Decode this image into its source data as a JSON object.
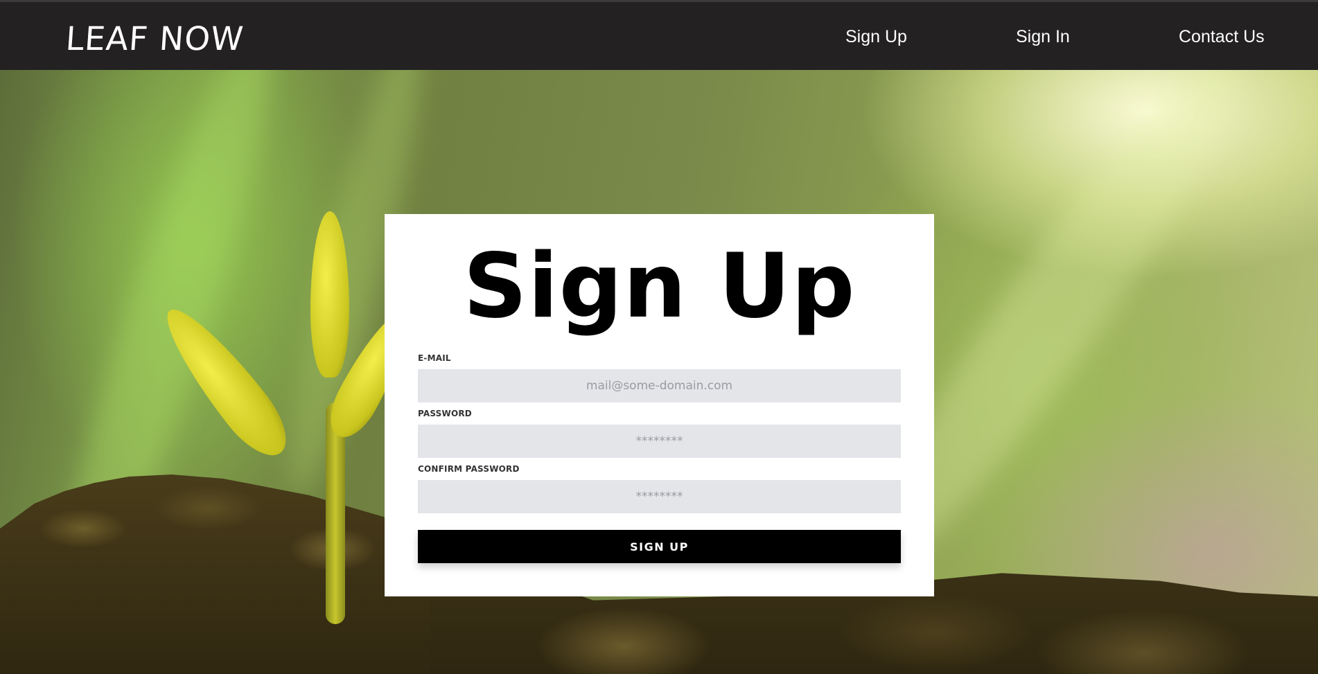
{
  "header": {
    "logo": "LEAF NOW",
    "nav": {
      "sign_up": "Sign Up",
      "sign_in": "Sign In",
      "contact_us": "Contact Us"
    }
  },
  "form": {
    "title": "Sign Up",
    "email": {
      "label": "E-MAIL",
      "placeholder": "mail@some-domain.com"
    },
    "password": {
      "label": "PASSWORD",
      "placeholder": "********"
    },
    "confirm_password": {
      "label": "CONFIRM PASSWORD",
      "placeholder": "********"
    },
    "submit_label": "SIGN UP"
  },
  "colors": {
    "header_bg": "#232122",
    "input_bg": "#e4e5e9",
    "button_bg": "#000000"
  }
}
